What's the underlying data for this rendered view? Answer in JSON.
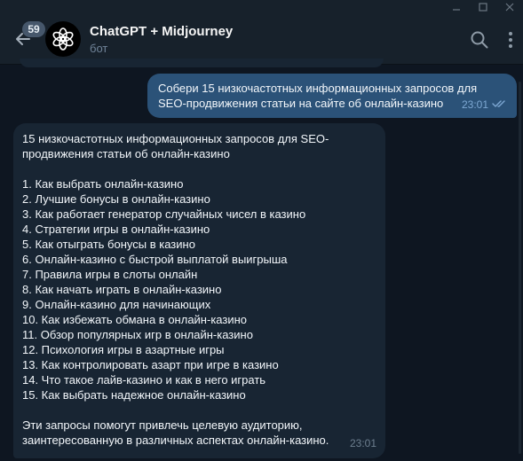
{
  "header": {
    "unread_count": "59",
    "title": "ChatGPT + Midjourney",
    "subtitle": "бот"
  },
  "messages": {
    "outgoing": {
      "text": "Собери 15 низкочастотных информационных запросов для SEO-продвижения статьи на сайте об онлайн-казино",
      "time": "23:01"
    },
    "incoming": {
      "intro": "15 низкочастотных информационных запросов для SEO-продвижения статьи об онлайн-казино",
      "items": [
        "1. Как выбрать онлайн-казино",
        "2. Лучшие бонусы в онлайн-казино",
        "3. Как работает генератор случайных чисел в казино",
        "4. Стратегии игры в онлайн-казино",
        "5. Как отыграть бонусы в казино",
        "6. Онлайн-казино с быстрой выплатой выигрыша",
        "7. Правила игры в слоты онлайн",
        "8. Как начать играть в онлайн-казино",
        "9. Онлайн-казино для начинающих",
        "10. Как избежать обмана в онлайн-казино",
        "11. Обзор популярных игр в онлайн-казино",
        "12. Психология игры в азартные игры",
        "13. Как контролировать азарт при игре в казино",
        "14. Что такое лайв-казино и как в него играть",
        "15. Как выбрать надежное онлайн-казино"
      ],
      "outro": "Эти запросы помогут привлечь целевую аудиторию, заинтересованную в различных аспектах онлайн-казино.",
      "time": "23:01"
    }
  },
  "icons": {
    "back": "arrow-left-icon",
    "avatar": "openai-logo-icon",
    "search": "search-icon",
    "more": "more-vertical-icon",
    "read": "double-check-icon"
  },
  "colors": {
    "background": "#0e1621",
    "header": "#17212b",
    "outgoing_bubble": "#2b5278",
    "incoming_bubble": "#182533",
    "subtitle": "#708499"
  }
}
